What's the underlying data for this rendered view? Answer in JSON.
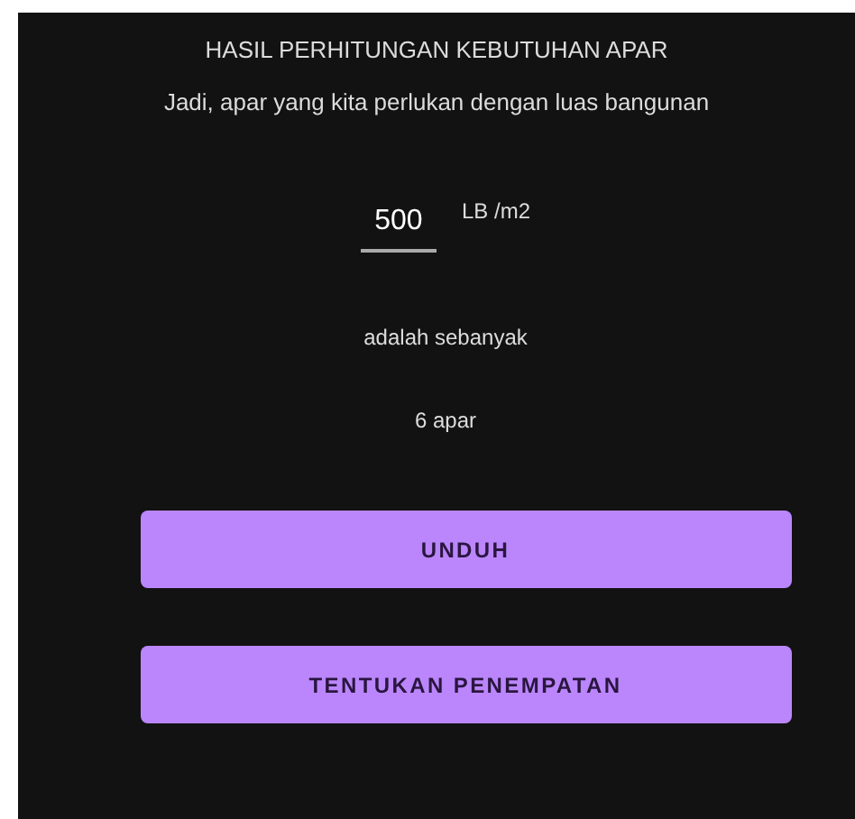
{
  "title": "HASIL PERHITUNGAN KEBUTUHAN APAR",
  "intro": "Jadi, apar yang kita perlukan dengan luas bangunan",
  "area_field": {
    "value": "500"
  },
  "unit": "LB /m2",
  "middle_text": "adalah sebanyak",
  "result": "6 apar",
  "buttons": [
    "UNDUH",
    "TENTUKAN PENEMPATAN"
  ]
}
